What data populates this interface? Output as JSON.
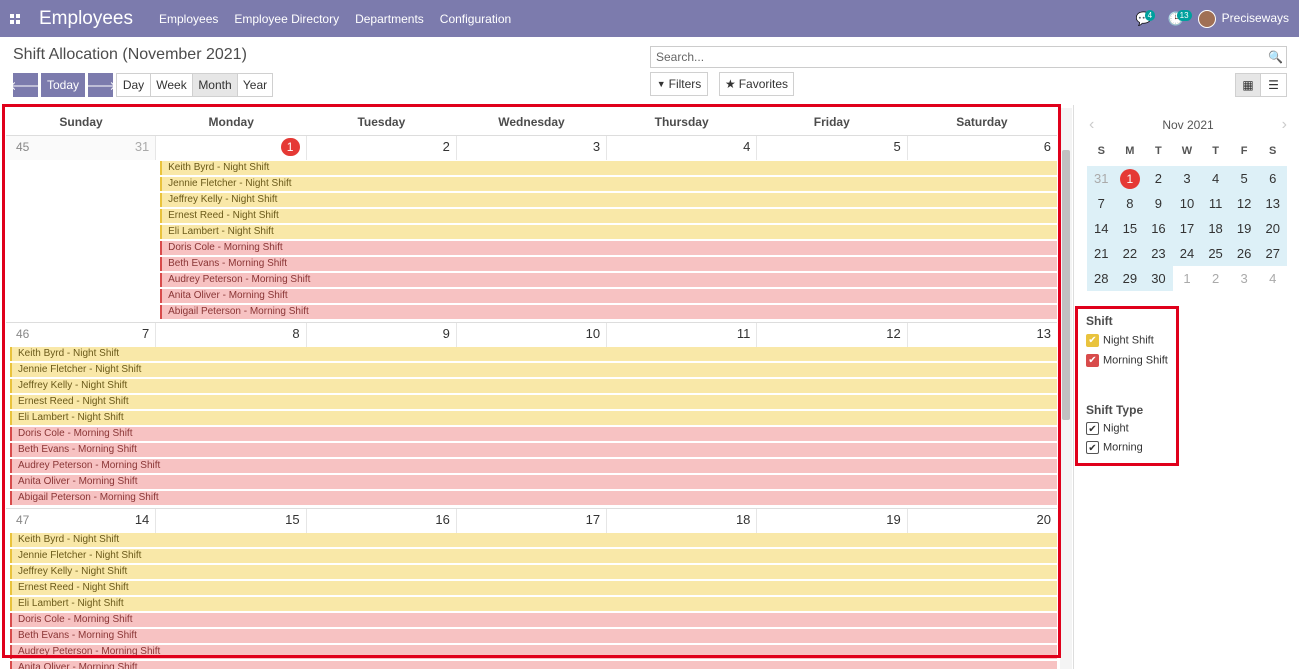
{
  "navbar": {
    "app_title": "Employees",
    "menus": [
      "Employees",
      "Employee Directory",
      "Departments",
      "Configuration"
    ],
    "messages_badge": "4",
    "activities_badge": "13",
    "user": "Preciseways"
  },
  "control": {
    "title": "Shift Allocation (November 2021)",
    "today": "Today",
    "views": [
      "Day",
      "Week",
      "Month",
      "Year"
    ],
    "active_view": "Month",
    "search_placeholder": "Search...",
    "filters": "Filters",
    "favorites": "Favorites"
  },
  "calendar": {
    "weekdays": [
      "Sunday",
      "Monday",
      "Tuesday",
      "Wednesday",
      "Thursday",
      "Friday",
      "Saturday"
    ],
    "weeks": [
      {
        "num": "45",
        "days": [
          "31",
          "1",
          "2",
          "3",
          "4",
          "5",
          "6"
        ],
        "start_col": 1
      },
      {
        "num": "46",
        "days": [
          "7",
          "8",
          "9",
          "10",
          "11",
          "12",
          "13"
        ],
        "start_col": 0
      },
      {
        "num": "47",
        "days": [
          "14",
          "15",
          "16",
          "17",
          "18",
          "19",
          "20"
        ],
        "start_col": 0
      }
    ],
    "events": [
      {
        "label": "Keith Byrd - Night Shift",
        "type": "night"
      },
      {
        "label": "Jennie Fletcher - Night Shift",
        "type": "night"
      },
      {
        "label": "Jeffrey Kelly - Night Shift",
        "type": "night"
      },
      {
        "label": "Ernest Reed - Night Shift",
        "type": "night"
      },
      {
        "label": "Eli Lambert - Night Shift",
        "type": "night"
      },
      {
        "label": "Doris Cole - Morning Shift",
        "type": "morning"
      },
      {
        "label": "Beth Evans - Morning Shift",
        "type": "morning"
      },
      {
        "label": "Audrey Peterson - Morning Shift",
        "type": "morning"
      },
      {
        "label": "Anita Oliver - Morning Shift",
        "type": "morning"
      },
      {
        "label": "Abigail Peterson - Morning Shift",
        "type": "morning"
      }
    ]
  },
  "mini_calendar": {
    "month": "Nov 2021",
    "dow": [
      "S",
      "M",
      "T",
      "W",
      "T",
      "F",
      "S"
    ],
    "rows": [
      [
        "31",
        "1",
        "2",
        "3",
        "4",
        "5",
        "6"
      ],
      [
        "7",
        "8",
        "9",
        "10",
        "11",
        "12",
        "13"
      ],
      [
        "14",
        "15",
        "16",
        "17",
        "18",
        "19",
        "20"
      ],
      [
        "21",
        "22",
        "23",
        "24",
        "25",
        "26",
        "27"
      ],
      [
        "28",
        "29",
        "30",
        "1",
        "2",
        "3",
        "4"
      ]
    ],
    "today": "1"
  },
  "filters": {
    "shift_heading": "Shift",
    "shift_items": [
      {
        "label": "Night Shift",
        "color": "#e9c33d"
      },
      {
        "label": "Morning Shift",
        "color": "#d84b4b"
      }
    ],
    "type_heading": "Shift Type",
    "type_items": [
      "Night",
      "Morning"
    ]
  }
}
